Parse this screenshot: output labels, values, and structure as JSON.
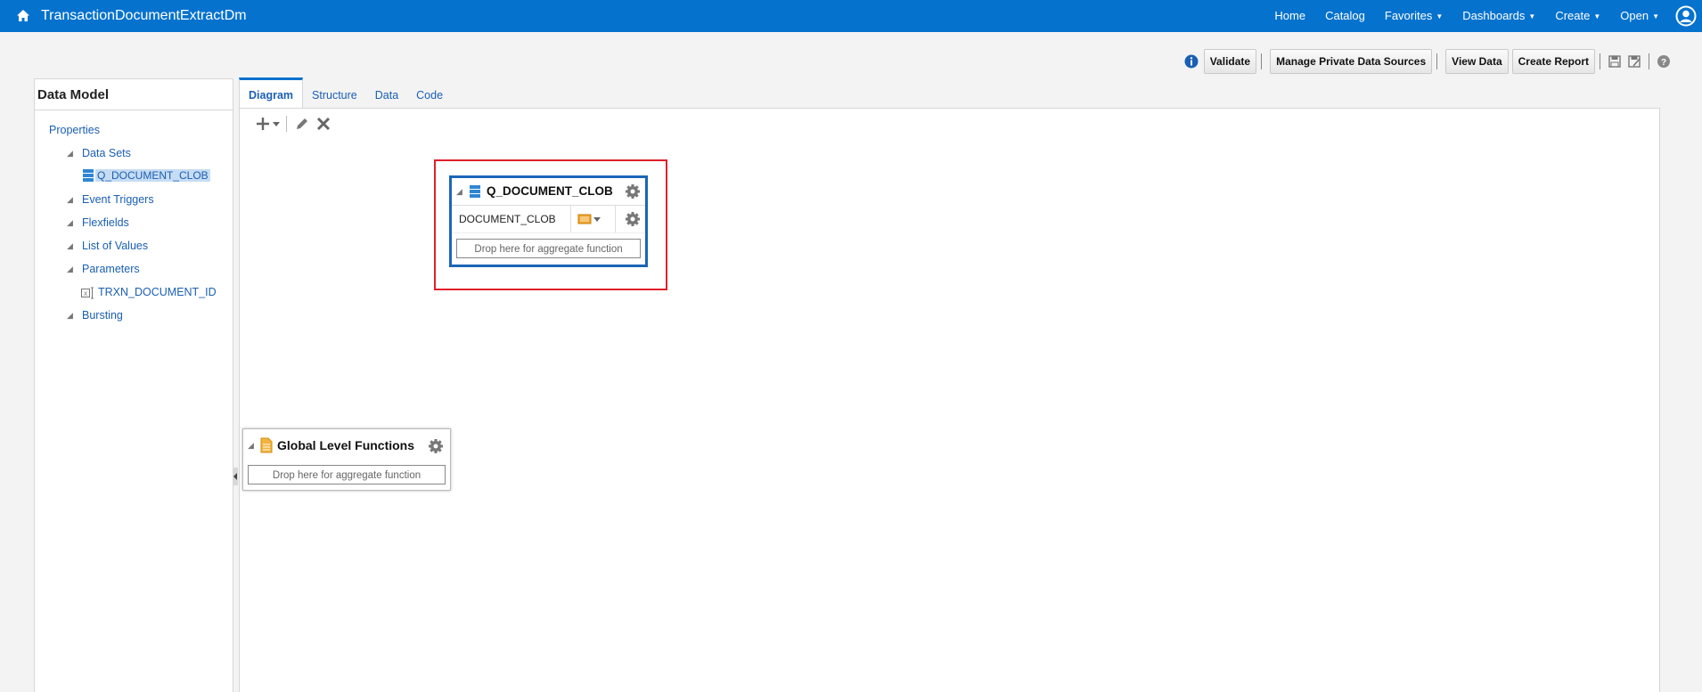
{
  "topbar": {
    "title": "TransactionDocumentExtractDm",
    "nav": [
      {
        "label": "Home",
        "has_menu": false
      },
      {
        "label": "Catalog",
        "has_menu": false
      },
      {
        "label": "Favorites",
        "has_menu": true
      },
      {
        "label": "Dashboards",
        "has_menu": true
      },
      {
        "label": "Create",
        "has_menu": true
      },
      {
        "label": "Open",
        "has_menu": true
      }
    ],
    "accent_color": "#0572ce"
  },
  "actions": {
    "validate": "Validate",
    "manage": "Manage Private Data Sources",
    "view_data": "View Data",
    "create_report": "Create Report",
    "icons": [
      "info-icon",
      "save-icon",
      "save-as-icon",
      "help-icon"
    ]
  },
  "left_panel": {
    "title": "Data Model",
    "properties": "Properties",
    "data_sets": "Data Sets",
    "dataset_q": "Q_DOCUMENT_CLOB",
    "event_triggers": "Event Triggers",
    "flexfields": "Flexfields",
    "list_of_values": "List of Values",
    "parameters": "Parameters",
    "param_trxn": "TRXN_DOCUMENT_ID",
    "bursting": "Bursting"
  },
  "tabs": [
    "Diagram",
    "Structure",
    "Data",
    "Code"
  ],
  "active_tab": "Diagram",
  "diagram": {
    "dataset_title": "Q_DOCUMENT_CLOB",
    "column_name": "DOCUMENT_CLOB",
    "drop_text": "Drop here for aggregate function",
    "global_title": "Global Level Functions",
    "global_drop_text": "Drop here for aggregate function"
  }
}
